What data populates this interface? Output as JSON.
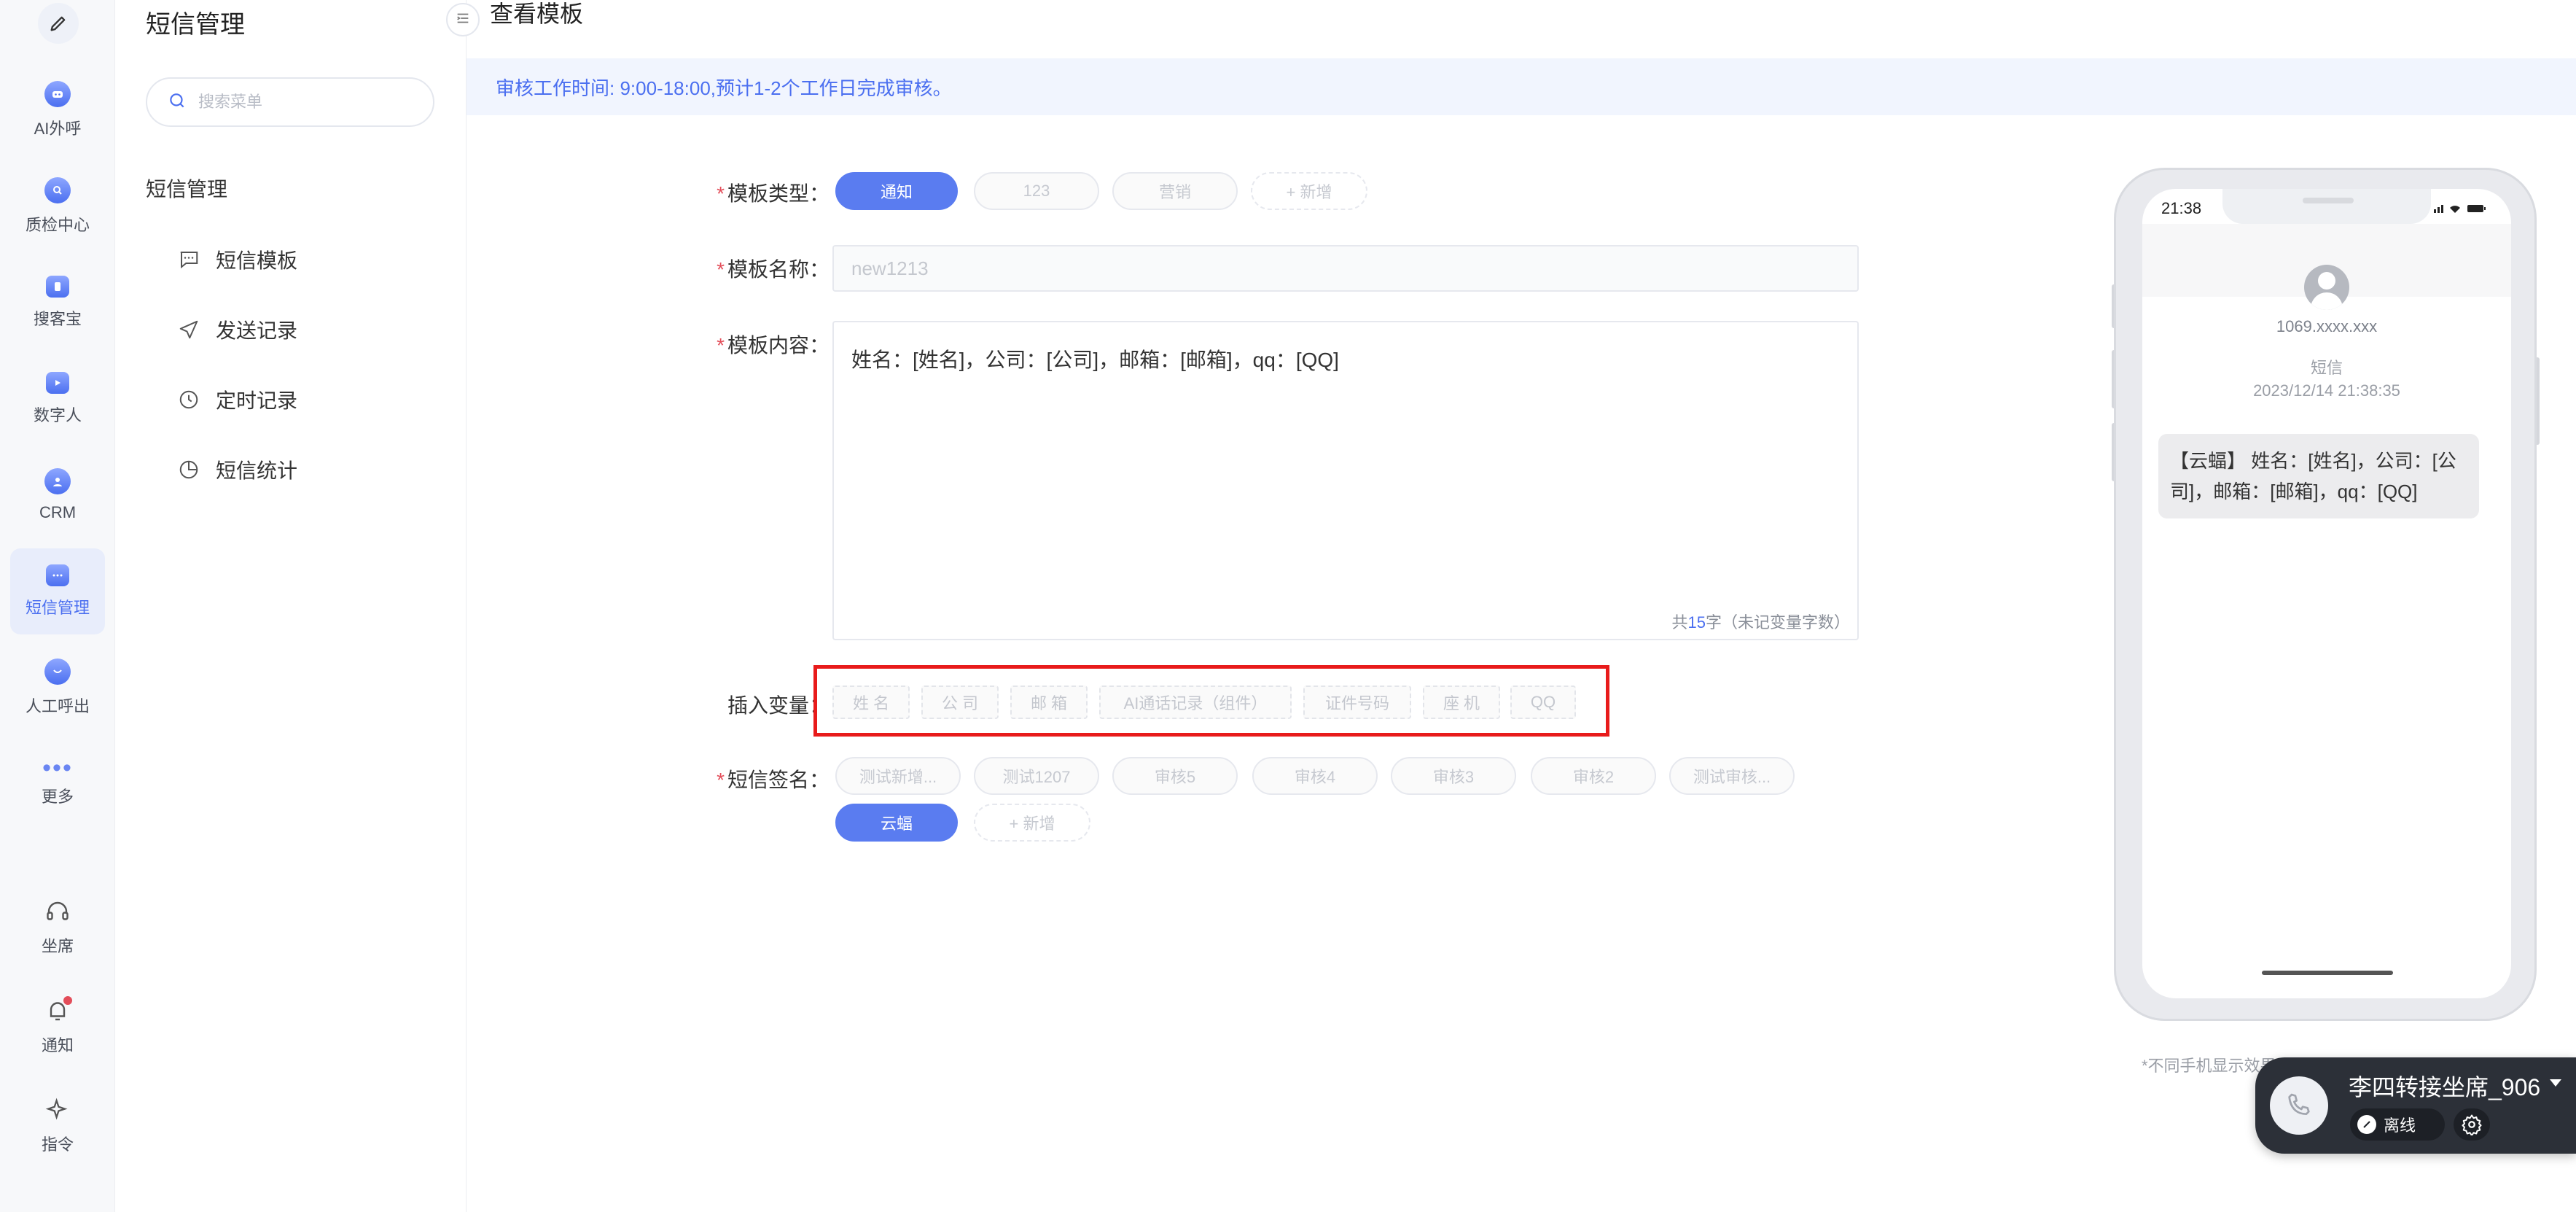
{
  "rail": {
    "items": [
      {
        "label": "AI外呼",
        "icon": "robot-icon"
      },
      {
        "label": "质检中心",
        "icon": "shield-search-icon"
      },
      {
        "label": "搜客宝",
        "icon": "phone-search-icon"
      },
      {
        "label": "数字人",
        "icon": "video-person-icon"
      },
      {
        "label": "CRM",
        "icon": "crm-user-icon"
      },
      {
        "label": "短信管理",
        "icon": "sms-icon"
      },
      {
        "label": "人工呼出",
        "icon": "outbound-call-icon"
      },
      {
        "label": "更多",
        "icon": "more-dots-icon"
      }
    ],
    "bottom": [
      {
        "label": "坐席",
        "icon": "headset-icon"
      },
      {
        "label": "通知",
        "icon": "bell-icon"
      },
      {
        "label": "指令",
        "icon": "sparkle-icon"
      }
    ]
  },
  "sidebar": {
    "title": "短信管理",
    "search_placeholder": "搜索菜单",
    "group": "短信管理",
    "items": [
      {
        "label": "短信模板",
        "icon": "message-icon"
      },
      {
        "label": "发送记录",
        "icon": "send-icon"
      },
      {
        "label": "定时记录",
        "icon": "clock-icon"
      },
      {
        "label": "短信统计",
        "icon": "pie-chart-icon"
      }
    ]
  },
  "main": {
    "page_title": "查看模板",
    "notice": "审核工作时间: 9:00-18:00,预计1-2个工作日完成审核。",
    "form": {
      "type_label": "模板类型：",
      "type_tags": [
        "通知",
        "123",
        "营销"
      ],
      "type_add": "+ 新增",
      "name_label": "模板名称：",
      "name_value": "new1213",
      "content_label": "模板内容：",
      "content_value": "姓名：[姓名]，公司：[公司]，邮箱：[邮箱]，qq：[QQ]",
      "counter_prefix": "共",
      "counter_num": "15",
      "counter_suffix": "字（未记变量字数）",
      "var_label": "插入变量：",
      "var_tags": [
        "姓 名",
        "公 司",
        "邮 箱",
        "AI通话记录（组件）",
        "证件号码",
        "座 机",
        "QQ"
      ],
      "sign_label": "短信签名：",
      "sign_tags": [
        "测试新增...",
        "测试1207",
        "审核5",
        "审核4",
        "审核3",
        "审核2",
        "测试审核..."
      ],
      "sign_selected": "云蝠",
      "sign_add": "+ 新增"
    }
  },
  "phone": {
    "time": "21:38",
    "sender": "1069.xxxx.xxx",
    "msg_type": "短信",
    "msg_time": "2023/12/14 21:38:35",
    "message": "【云蝠】 姓名：[姓名]，公司：[公司]，邮箱：[邮箱]，qq：[QQ]",
    "note": "*不同手机显示效果可能会有所差异，仅供参考"
  },
  "call_widget": {
    "name": "李四转接坐席_906",
    "status": "离线"
  },
  "colors": {
    "accent": "#5a7cf0",
    "required": "#e34d59",
    "highlight_box": "#e81b1b"
  }
}
